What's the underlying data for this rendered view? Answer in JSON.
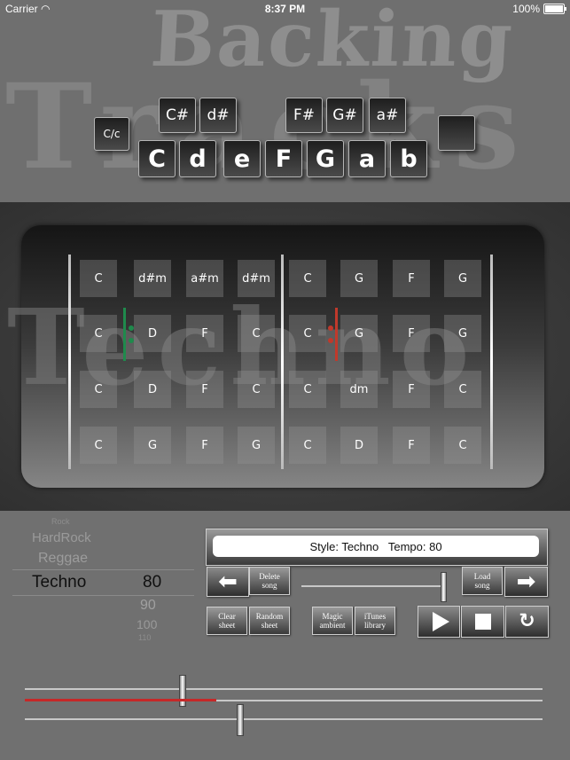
{
  "status_bar": {
    "carrier": "Carrier",
    "time": "8:37 PM",
    "battery": "100%"
  },
  "header": {
    "title_backing": "Backing",
    "title_tracks": "Tracks",
    "mode_key": "C/c",
    "sharp_keys": [
      "C#",
      "d#",
      "F#",
      "G#",
      "a#"
    ],
    "natural_keys": [
      "C",
      "d",
      "e",
      "F",
      "G",
      "a",
      "b"
    ]
  },
  "sheet": {
    "watermark": "Techno",
    "rows": [
      [
        "C",
        "d#m",
        "a#m",
        "d#m",
        "C",
        "G",
        "F",
        "G"
      ],
      [
        "C",
        "D",
        "F",
        "C",
        "C",
        "G",
        "F",
        "G"
      ],
      [
        "C",
        "D",
        "F",
        "C",
        "C",
        "dm",
        "F",
        "C"
      ],
      [
        "C",
        "G",
        "F",
        "G",
        "C",
        "D",
        "F",
        "C"
      ]
    ],
    "repeat_start_color": "#1f8a4c",
    "repeat_end_color": "#c0392b"
  },
  "controls": {
    "style_picker": {
      "items": [
        "Rock",
        "HardRock",
        "Reggae",
        "Techno"
      ],
      "selected": "Techno"
    },
    "tempo_picker": {
      "items": [
        "80",
        "90",
        "100",
        "110"
      ],
      "selected": "80"
    },
    "info_text": "Style: Techno   Tempo: 80",
    "delete_song": "Delete song",
    "load_song": "Load song",
    "clear_sheet": "Clear sheet",
    "random_sheet": "Random sheet",
    "magic_ambient": "Magic ambient",
    "itunes_library": "iTunes library",
    "progress_fraction": 0.37,
    "accent_red": "#c62828"
  }
}
